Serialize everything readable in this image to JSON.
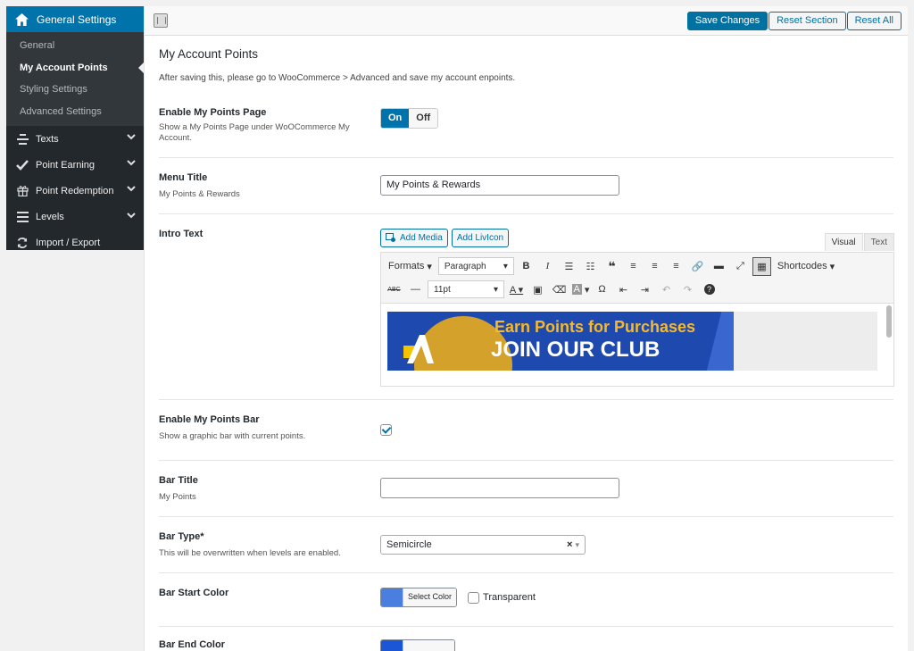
{
  "sidebar": {
    "head": {
      "label": "General Settings",
      "icon": "home-icon"
    },
    "sub_items": [
      {
        "label": "General",
        "active": false
      },
      {
        "label": "My Account Points",
        "active": true
      },
      {
        "label": "Styling Settings",
        "active": false
      },
      {
        "label": "Advanced Settings",
        "active": false
      }
    ],
    "menu": [
      {
        "label": "Texts",
        "icon": "text-icon",
        "chevron": true
      },
      {
        "label": "Point Earning",
        "icon": "checkmark-icon",
        "chevron": true
      },
      {
        "label": "Point Redemption",
        "icon": "gift-icon",
        "chevron": true
      },
      {
        "label": "Levels",
        "icon": "list-icon",
        "chevron": true
      },
      {
        "label": "Import / Export",
        "icon": "refresh-icon",
        "chevron": false
      }
    ]
  },
  "topbar": {
    "save_label": "Save Changes",
    "reset_section_label": "Reset Section",
    "reset_all_label": "Reset All"
  },
  "section": {
    "title": "My Account Points",
    "description": "After saving this, please go to WooCommerce > Advanced and save my account enpoints."
  },
  "fields": {
    "enable_page": {
      "label": "Enable My Points Page",
      "desc": "Show a My Points Page under WoOCommerce My Account.",
      "on": "On",
      "off": "Off"
    },
    "menu_title": {
      "label": "Menu Title",
      "desc": "My Points & Rewards",
      "value": "My Points & Rewards"
    },
    "intro_text": {
      "label": "Intro Text",
      "add_media": "Add Media",
      "add_livicon": "Add LivIcon",
      "tab_visual": "Visual",
      "tab_text": "Text",
      "formats": "Formats",
      "paragraph": "Paragraph",
      "shortcodes": "Shortcodes",
      "font_size": "11pt",
      "banner_line1": "Earn Points for Purchases",
      "banner_line2": "JOIN OUR CLUB"
    },
    "enable_bar": {
      "label": "Enable My Points Bar",
      "desc": "Show a graphic bar with current points.",
      "checked": true
    },
    "bar_title": {
      "label": "Bar Title",
      "desc": "My Points",
      "value": ""
    },
    "bar_type": {
      "label": "Bar Type*",
      "desc": "This will be overwritten when levels are enabled.",
      "value": "Semicircle"
    },
    "bar_start": {
      "label": "Bar Start Color",
      "button": "Select Color",
      "transparent": "Transparent",
      "color": "#4a7fe0"
    },
    "bar_end": {
      "label": "Bar End Color",
      "color": "#1a56d6"
    }
  },
  "colors": {
    "accent": "#0073aa",
    "sidebar_bg": "#23282d",
    "banner_blue": "#1e4ab0",
    "banner_gold": "#f5b92b"
  }
}
